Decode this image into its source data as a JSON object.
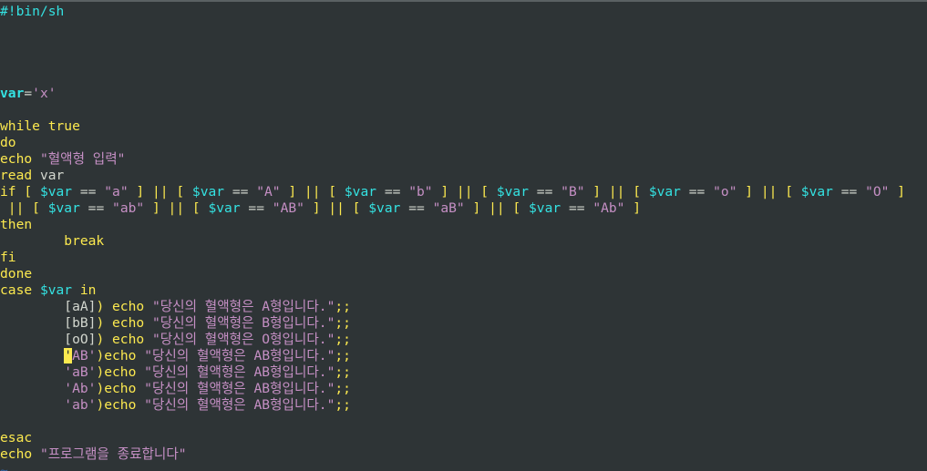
{
  "editor": {
    "lines": [
      {
        "row": 0,
        "tokens": [
          {
            "t": "#!bin/sh",
            "c": "cy"
          }
        ]
      },
      {
        "row": 5,
        "tokens": [
          {
            "t": "var",
            "c": "var"
          },
          {
            "t": "=",
            "c": "br"
          },
          {
            "t": "'x'",
            "c": "str"
          }
        ]
      },
      {
        "row": 7,
        "tokens": [
          {
            "t": "while true",
            "c": "kw"
          }
        ]
      },
      {
        "row": 8,
        "tokens": [
          {
            "t": "do",
            "c": "kw"
          }
        ]
      },
      {
        "row": 9,
        "tokens": [
          {
            "t": "echo ",
            "c": "kw"
          },
          {
            "t": "\"혈액형 입력\"",
            "c": "str"
          }
        ]
      },
      {
        "row": 10,
        "tokens": [
          {
            "t": "read",
            "c": "kw"
          },
          {
            "t": " var",
            "c": "br"
          }
        ]
      },
      {
        "row": 11,
        "tokens": [
          {
            "t": "if",
            "c": "kw"
          },
          {
            "t": " [ ",
            "c": "kw"
          },
          {
            "t": "$var",
            "c": "cy"
          },
          {
            "t": " == ",
            "c": "br"
          },
          {
            "t": "\"a\"",
            "c": "str"
          },
          {
            "t": " ] || [ ",
            "c": "kw"
          },
          {
            "t": "$var",
            "c": "cy"
          },
          {
            "t": " == ",
            "c": "br"
          },
          {
            "t": "\"A\"",
            "c": "str"
          },
          {
            "t": " ] || [ ",
            "c": "kw"
          },
          {
            "t": "$var",
            "c": "cy"
          },
          {
            "t": " == ",
            "c": "br"
          },
          {
            "t": "\"b\"",
            "c": "str"
          },
          {
            "t": " ] || [ ",
            "c": "kw"
          },
          {
            "t": "$var",
            "c": "cy"
          },
          {
            "t": " == ",
            "c": "br"
          },
          {
            "t": "\"B\"",
            "c": "str"
          },
          {
            "t": " ] || [ ",
            "c": "kw"
          },
          {
            "t": "$var",
            "c": "cy"
          },
          {
            "t": " == ",
            "c": "br"
          },
          {
            "t": "\"o\"",
            "c": "str"
          },
          {
            "t": " ] || [ ",
            "c": "kw"
          },
          {
            "t": "$var",
            "c": "cy"
          },
          {
            "t": " == ",
            "c": "br"
          },
          {
            "t": "\"O\"",
            "c": "str"
          },
          {
            "t": " ]",
            "c": "kw"
          }
        ]
      },
      {
        "row": 12,
        "tokens": [
          {
            "t": " || [ ",
            "c": "kw"
          },
          {
            "t": "$var",
            "c": "cy"
          },
          {
            "t": " == ",
            "c": "br"
          },
          {
            "t": "\"ab\"",
            "c": "str"
          },
          {
            "t": " ] || [ ",
            "c": "kw"
          },
          {
            "t": "$var",
            "c": "cy"
          },
          {
            "t": " == ",
            "c": "br"
          },
          {
            "t": "\"AB\"",
            "c": "str"
          },
          {
            "t": " ] || [ ",
            "c": "kw"
          },
          {
            "t": "$var",
            "c": "cy"
          },
          {
            "t": " == ",
            "c": "br"
          },
          {
            "t": "\"aB\"",
            "c": "str"
          },
          {
            "t": " ] || [ ",
            "c": "kw"
          },
          {
            "t": "$var",
            "c": "cy"
          },
          {
            "t": " == ",
            "c": "br"
          },
          {
            "t": "\"Ab\"",
            "c": "str"
          },
          {
            "t": " ]",
            "c": "kw"
          }
        ]
      },
      {
        "row": 13,
        "tokens": [
          {
            "t": "then",
            "c": "kw"
          }
        ]
      },
      {
        "row": 14,
        "tokens": [
          {
            "t": "        break",
            "c": "kw"
          }
        ]
      },
      {
        "row": 15,
        "tokens": [
          {
            "t": "fi",
            "c": "kw"
          }
        ]
      },
      {
        "row": 16,
        "tokens": [
          {
            "t": "done",
            "c": "kw"
          }
        ]
      },
      {
        "row": 17,
        "tokens": [
          {
            "t": "case ",
            "c": "kw"
          },
          {
            "t": "$var",
            "c": "cy"
          },
          {
            "t": " in",
            "c": "kw"
          }
        ]
      },
      {
        "row": 18,
        "tokens": [
          {
            "t": "        [aA]",
            "c": "br"
          },
          {
            "t": ") ",
            "c": "kw"
          },
          {
            "t": "echo ",
            "c": "kw"
          },
          {
            "t": "\"당신의 혈액형은 A형입니다.\"",
            "c": "str"
          },
          {
            "t": ";;",
            "c": "kw"
          }
        ]
      },
      {
        "row": 19,
        "tokens": [
          {
            "t": "        [bB]",
            "c": "br"
          },
          {
            "t": ") ",
            "c": "kw"
          },
          {
            "t": "echo ",
            "c": "kw"
          },
          {
            "t": "\"당신의 혈액형은 B형입니다.\"",
            "c": "str"
          },
          {
            "t": ";;",
            "c": "kw"
          }
        ]
      },
      {
        "row": 20,
        "tokens": [
          {
            "t": "        [oO]",
            "c": "br"
          },
          {
            "t": ") ",
            "c": "kw"
          },
          {
            "t": "echo ",
            "c": "kw"
          },
          {
            "t": "\"당신의 혈액형은 O형입니다.\"",
            "c": "str"
          },
          {
            "t": ";;",
            "c": "kw"
          }
        ]
      },
      {
        "row": 21,
        "tokens": [
          {
            "t": "        ",
            "c": "br"
          },
          {
            "t": "'",
            "c": "cursor"
          },
          {
            "t": "AB'",
            "c": "str"
          },
          {
            "t": ")",
            "c": "kw"
          },
          {
            "t": "echo ",
            "c": "kw"
          },
          {
            "t": "\"당신의 혈액형은 AB형입니다.\"",
            "c": "str"
          },
          {
            "t": ";;",
            "c": "kw"
          }
        ]
      },
      {
        "row": 22,
        "tokens": [
          {
            "t": "        'aB'",
            "c": "str"
          },
          {
            "t": ")",
            "c": "kw"
          },
          {
            "t": "echo ",
            "c": "kw"
          },
          {
            "t": "\"당신의 혈액형은 AB형입니다.\"",
            "c": "str"
          },
          {
            "t": ";;",
            "c": "kw"
          }
        ]
      },
      {
        "row": 23,
        "tokens": [
          {
            "t": "        'Ab'",
            "c": "str"
          },
          {
            "t": ")",
            "c": "kw"
          },
          {
            "t": "echo ",
            "c": "kw"
          },
          {
            "t": "\"당신의 혈액형은 AB형입니다.\"",
            "c": "str"
          },
          {
            "t": ";;",
            "c": "kw"
          }
        ]
      },
      {
        "row": 24,
        "tokens": [
          {
            "t": "        'ab'",
            "c": "str"
          },
          {
            "t": ")",
            "c": "kw"
          },
          {
            "t": "echo ",
            "c": "kw"
          },
          {
            "t": "\"당신의 혈액형은 AB형입니다.\"",
            "c": "str"
          },
          {
            "t": ";;",
            "c": "kw"
          }
        ]
      },
      {
        "row": 26,
        "tokens": [
          {
            "t": "esac",
            "c": "kw"
          }
        ]
      },
      {
        "row": 27,
        "tokens": [
          {
            "t": "echo ",
            "c": "kw"
          },
          {
            "t": "\"프로그램을 종료합니다\"",
            "c": "str"
          }
        ]
      },
      {
        "row": 28,
        "tokens": [
          {
            "t": "~",
            "c": "tilde"
          }
        ]
      }
    ]
  }
}
